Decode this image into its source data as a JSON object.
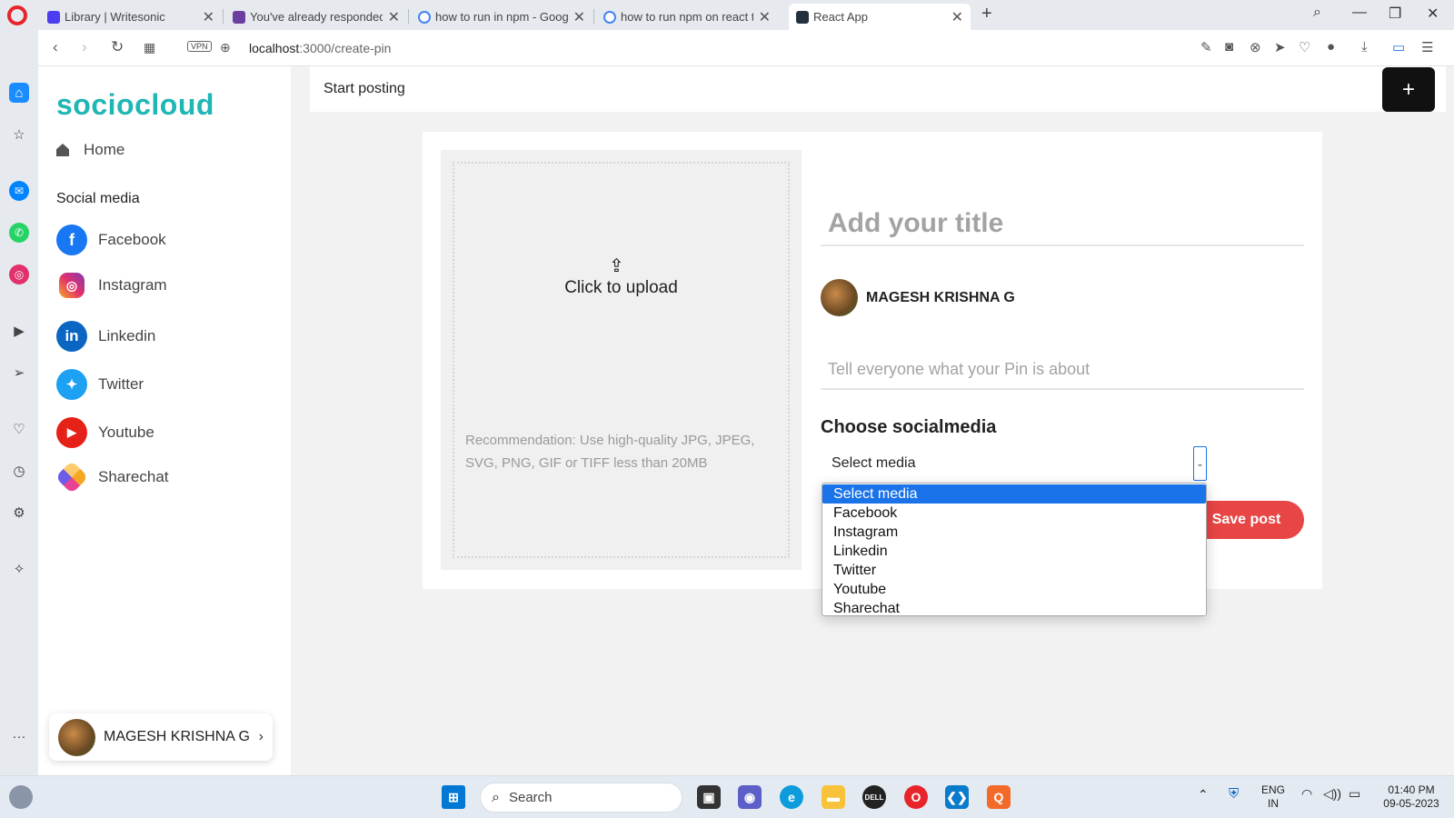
{
  "browser": {
    "tabs": [
      {
        "title": "Library | Writesonic",
        "color": "#4b3df0"
      },
      {
        "title": "You've already responded",
        "color": "#6b3fa0"
      },
      {
        "title": "how to run in npm - Googl",
        "color": "#4285f4"
      },
      {
        "title": "how to run npm on react to",
        "color": "#4285f4"
      },
      {
        "title": "React App",
        "color": "#23313f"
      }
    ],
    "active_tab": 4,
    "url_host": "localhost",
    "url_path": ":3000/create-pin",
    "vpn_label": "VPN"
  },
  "sidebar": {
    "brand": "sociocloud",
    "home_label": "Home",
    "section_title": "Social media",
    "items": [
      {
        "label": "Facebook",
        "icon": "facebook-icon",
        "color": "#1877f2"
      },
      {
        "label": "Instagram",
        "icon": "instagram-icon",
        "color": "#e1306c"
      },
      {
        "label": "Linkedin",
        "icon": "linkedin-icon",
        "color": "#0a66c2"
      },
      {
        "label": "Twitter",
        "icon": "twitter-icon",
        "color": "#1da1f2"
      },
      {
        "label": "Youtube",
        "icon": "youtube-icon",
        "color": "#e62117"
      },
      {
        "label": "Sharechat",
        "icon": "sharechat-icon",
        "color": "#f5a623"
      }
    ],
    "user_name": "MAGESH KRISHNA G"
  },
  "header": {
    "title": "Start posting",
    "add_label": "+"
  },
  "form": {
    "upload_label": "Click to upload",
    "recommendation": "Recommendation: Use high-quality JPG, JPEG, SVG, PNG, GIF or TIFF less than 20MB",
    "title_placeholder": "Add your title",
    "author_name": "MAGESH KRISHNA G",
    "about_placeholder": "Tell everyone what your Pin is about",
    "choose_label": "Choose socialmedia",
    "select_value": "Select media",
    "options": [
      "Select media",
      "Facebook",
      "Instagram",
      "Linkedin",
      "Twitter",
      "Youtube",
      "Sharechat"
    ],
    "save_label": "Save post"
  },
  "taskbar": {
    "search_label": "Search",
    "lang_line1": "ENG",
    "lang_line2": "IN",
    "time": "01:40 PM",
    "date": "09-05-2023"
  },
  "colors": {
    "brand": "#1fb6b4",
    "save": "#e84545",
    "select_highlight": "#1a73e8"
  }
}
